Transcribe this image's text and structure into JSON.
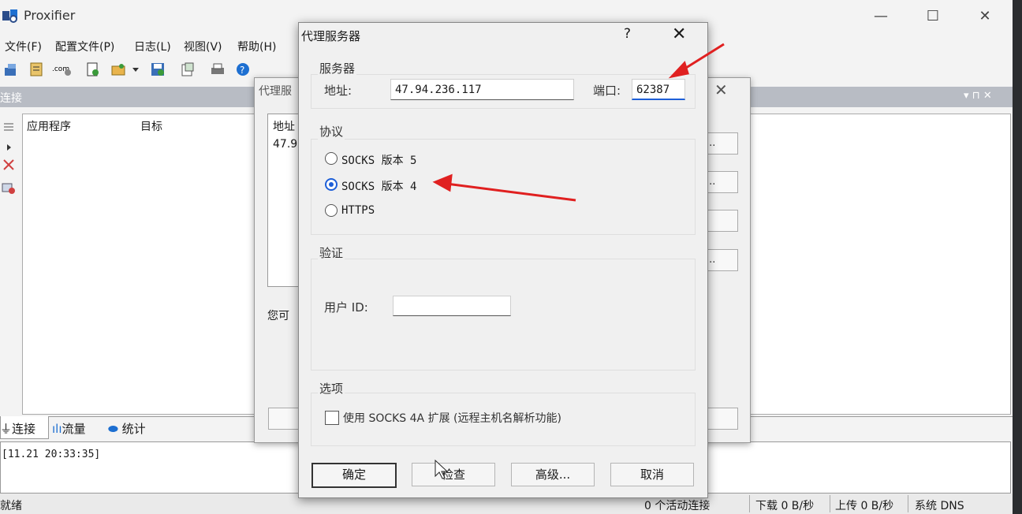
{
  "main": {
    "title": "Proxifier",
    "menu": [
      "文件(F)",
      "配置文件(P)",
      "日志(L)",
      "视图(V)",
      "帮助(H)"
    ],
    "toolbar_icons": [
      "new-profile-icon",
      "open-icon",
      "com-icon",
      "document-icon",
      "folder-icon",
      "dropdown-icon",
      "save-icon",
      "export-icon",
      "print-icon",
      "help-icon"
    ],
    "panel_title": "连接",
    "columns": [
      "应用程序",
      "目标"
    ],
    "bottom_tabs": [
      "连接",
      "流量",
      "统计"
    ],
    "log_line": "[11.21 20:33:35]",
    "status": {
      "ready": "就绪",
      "active": "0 个活动连接",
      "download": "下载 0 B/秒",
      "upload": "上传 0 B/秒",
      "dns": "系统 DNS"
    }
  },
  "bg_dialog": {
    "title": "代理服",
    "column": "地址",
    "row": "47.9",
    "hint": "您可",
    "button_label": "..."
  },
  "dialog": {
    "title": "代理服务器",
    "help": "?",
    "server_group": "服务器",
    "address_label": "地址:",
    "address_value": "47.94.236.117",
    "port_label": "端口:",
    "port_value": "62387",
    "protocol_group": "协议",
    "protocols": [
      "SOCKS 版本 5",
      "SOCKS 版本 4",
      "HTTPS"
    ],
    "selected_protocol": "SOCKS 版本 4",
    "auth_group": "验证",
    "userid_label": "用户 ID:",
    "userid_value": "",
    "options_group": "选项",
    "socks4a_label": "使用 SOCKS 4A 扩展 (远程主机名解析功能)",
    "socks4a_checked": false,
    "buttons": {
      "ok": "确定",
      "check": "检查",
      "advanced": "高级...",
      "cancel": "取消"
    }
  },
  "colors": {
    "accent": "#1e5fd8",
    "arrow": "#e02020"
  }
}
